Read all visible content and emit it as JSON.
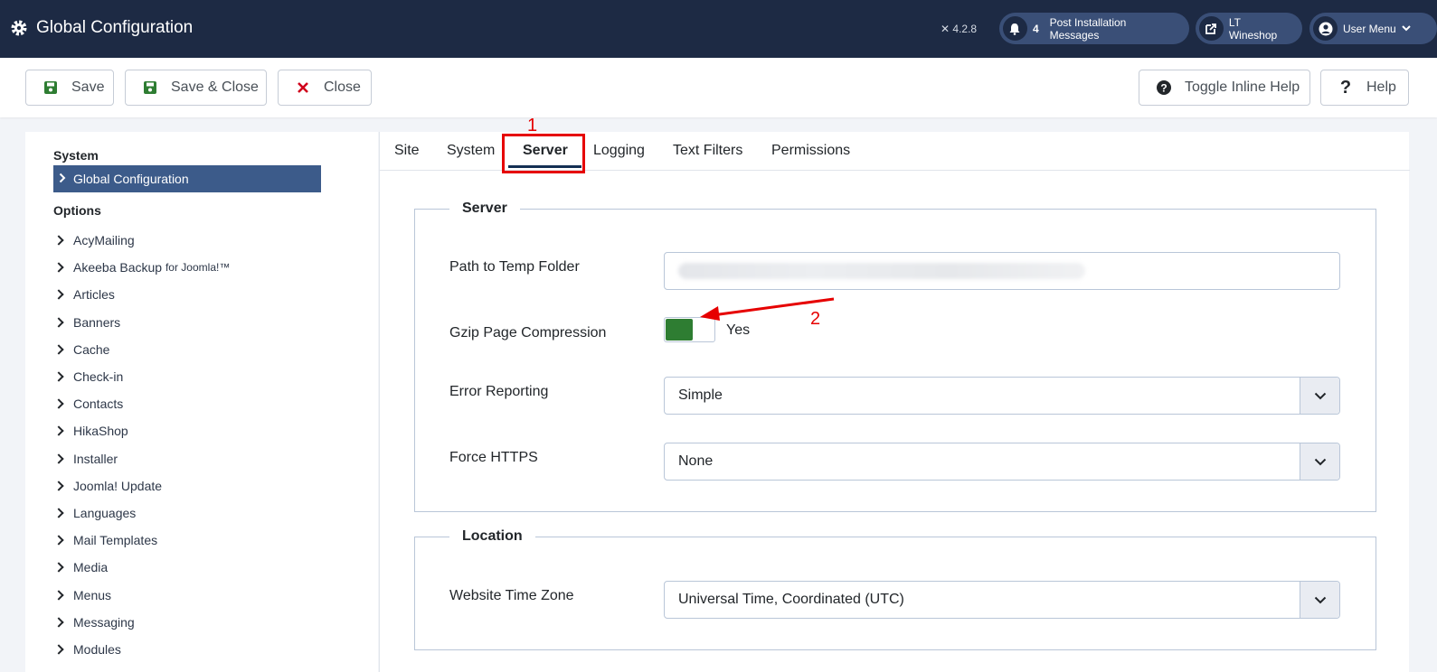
{
  "header": {
    "title": "Global Configuration",
    "version": "4.2.8",
    "notifications_count": "4",
    "post_install_label": "Post Installation Messages",
    "site_label": "LT Wineshop",
    "user_menu_label": "User Menu"
  },
  "toolbar": {
    "save": "Save",
    "save_close": "Save & Close",
    "close": "Close",
    "toggle_help": "Toggle Inline Help",
    "help": "Help"
  },
  "sidebar": {
    "system_heading": "System",
    "active_item": "Global Configuration",
    "options_heading": "Options",
    "items": [
      {
        "label": "AcyMailing"
      },
      {
        "label": "Akeeba Backup",
        "suffix": "for Joomla!™"
      },
      {
        "label": "Articles"
      },
      {
        "label": "Banners"
      },
      {
        "label": "Cache"
      },
      {
        "label": "Check-in"
      },
      {
        "label": "Contacts"
      },
      {
        "label": "HikaShop"
      },
      {
        "label": "Installer"
      },
      {
        "label": "Joomla! Update"
      },
      {
        "label": "Languages"
      },
      {
        "label": "Mail Templates"
      },
      {
        "label": "Media"
      },
      {
        "label": "Menus"
      },
      {
        "label": "Messaging"
      },
      {
        "label": "Modules"
      }
    ]
  },
  "tabs": [
    "Site",
    "System",
    "Server",
    "Logging",
    "Text Filters",
    "Permissions"
  ],
  "annotations": {
    "one": "1",
    "two": "2"
  },
  "server": {
    "legend": "Server",
    "temp_folder_label": "Path to Temp Folder",
    "gzip_label": "Gzip Page Compression",
    "gzip_value": "Yes",
    "error_reporting_label": "Error Reporting",
    "error_reporting_value": "Simple",
    "force_https_label": "Force HTTPS",
    "force_https_value": "None"
  },
  "location": {
    "legend": "Location",
    "timezone_label": "Website Time Zone",
    "timezone_value": "Universal Time, Coordinated (UTC)"
  },
  "colors": {
    "header_bg": "#1d2a44",
    "active_item_bg": "#3c5b8a",
    "toggle_on": "#2e7d32",
    "annotation_red": "#e60000"
  }
}
